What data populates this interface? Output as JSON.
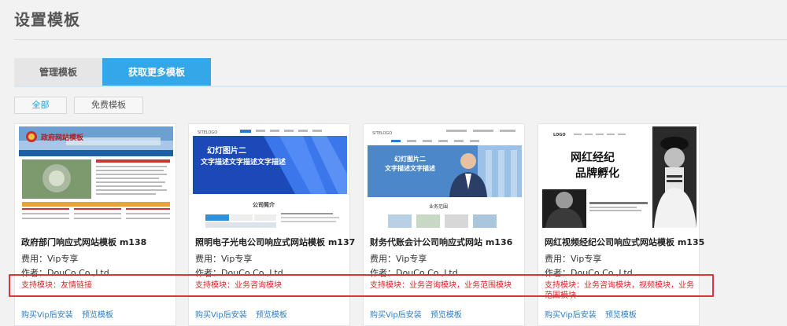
{
  "page": {
    "title": "设置模板"
  },
  "tabs": [
    {
      "label": "管理模板",
      "active": false
    },
    {
      "label": "获取更多模板",
      "active": true
    }
  ],
  "filters": [
    {
      "label": "全部"
    },
    {
      "label": "免费模板"
    }
  ],
  "templates": [
    {
      "name": "政府部门响应式网站模板 m138",
      "fee": "费用：Vip专享",
      "author": "作者：DouCo Co.,Ltd",
      "modules": "支持模块：友情链接",
      "buy": "购买Vip后安装",
      "preview": "预览模板",
      "thumb": {
        "banner": "政府网站模板",
        "footer_dots": ""
      }
    },
    {
      "name": "照明电子光电公司响应式网站模板 m137",
      "fee": "费用：Vip专享",
      "author": "作者：DouCo Co.,Ltd",
      "modules": "支持模块：业务咨询模块",
      "buy": "购买Vip后安装",
      "preview": "预览模板",
      "thumb": {
        "logo": "SITELOGO",
        "slide1": "幻灯图片二",
        "slide2": "文字描述文字描述文字描述",
        "section": "公司简介"
      }
    },
    {
      "name": "财务代账会计公司响应式网站 m136",
      "fee": "费用：Vip专享",
      "author": "作者：DouCo Co.,Ltd",
      "modules": "支持模块：业务咨询模块，业务范围模块",
      "buy": "购买Vip后安装",
      "preview": "预览模板",
      "thumb": {
        "logo": "SITELOGO",
        "slide1": "幻灯图片二",
        "slide2": "文字描述文字描述",
        "section": "业务范围"
      }
    },
    {
      "name": "网红视频经纪公司响应式网站模板 m135",
      "fee": "费用：Vip专享",
      "author": "作者：DouCo Co.,Ltd",
      "modules": "支持模块：业务咨询模块，视频模块，业务范围模块",
      "buy": "购买Vip后安装",
      "preview": "预览模板",
      "thumb": {
        "logo": "LOGO",
        "slide1": "网红经纪",
        "slide2": "品牌孵化"
      }
    }
  ],
  "colors": {
    "accent": "#33a7e7",
    "highlight": "#d9363e",
    "module_text": "#d42a2a",
    "link": "#2e7fc7"
  }
}
